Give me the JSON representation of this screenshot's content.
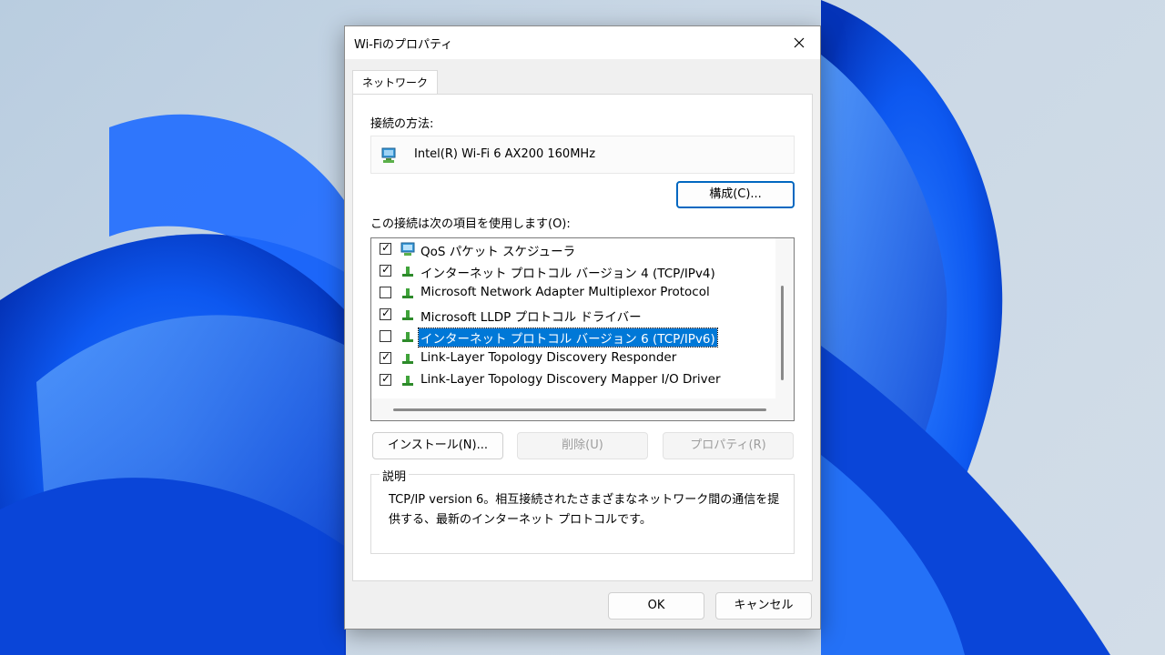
{
  "window": {
    "title": "Wi-Fiのプロパティ"
  },
  "tabs": [
    {
      "label": "ネットワーク"
    }
  ],
  "connect_using": {
    "label": "接続の方法:",
    "adapter": "Intel(R) Wi-Fi 6 AX200 160MHz",
    "configure_button": "構成(C)..."
  },
  "items_section": {
    "label": "この接続は次の項目を使用します(O):",
    "items": [
      {
        "label": "QoS パケット スケジューラ",
        "checked": true,
        "icon": "network-monitor-icon"
      },
      {
        "label": "インターネット プロトコル バージョン 4 (TCP/IPv4)",
        "checked": true,
        "icon": "protocol-icon"
      },
      {
        "label": "Microsoft Network Adapter Multiplexor Protocol",
        "checked": false,
        "icon": "protocol-icon"
      },
      {
        "label": "Microsoft LLDP プロトコル ドライバー",
        "checked": true,
        "icon": "protocol-icon"
      },
      {
        "label": "インターネット プロトコル バージョン 6 (TCP/IPv6)",
        "checked": false,
        "icon": "protocol-icon",
        "selected": true
      },
      {
        "label": "Link-Layer Topology Discovery Responder",
        "checked": true,
        "icon": "protocol-icon"
      },
      {
        "label": "Link-Layer Topology Discovery Mapper I/O Driver",
        "checked": true,
        "icon": "protocol-icon"
      }
    ]
  },
  "actions": {
    "install": "インストール(N)...",
    "uninstall": "削除(U)",
    "properties": "プロパティ(R)"
  },
  "description": {
    "title": "説明",
    "text": "TCP/IP version 6。相互接続されたさまざまなネットワーク間の通信を提供する、最新のインターネット プロトコルです。"
  },
  "footer": {
    "ok": "OK",
    "cancel": "キャンセル"
  },
  "colors": {
    "accent": "#0067c0",
    "selection": "#0078d7",
    "wallpaper_blue": "#0a5bff"
  }
}
